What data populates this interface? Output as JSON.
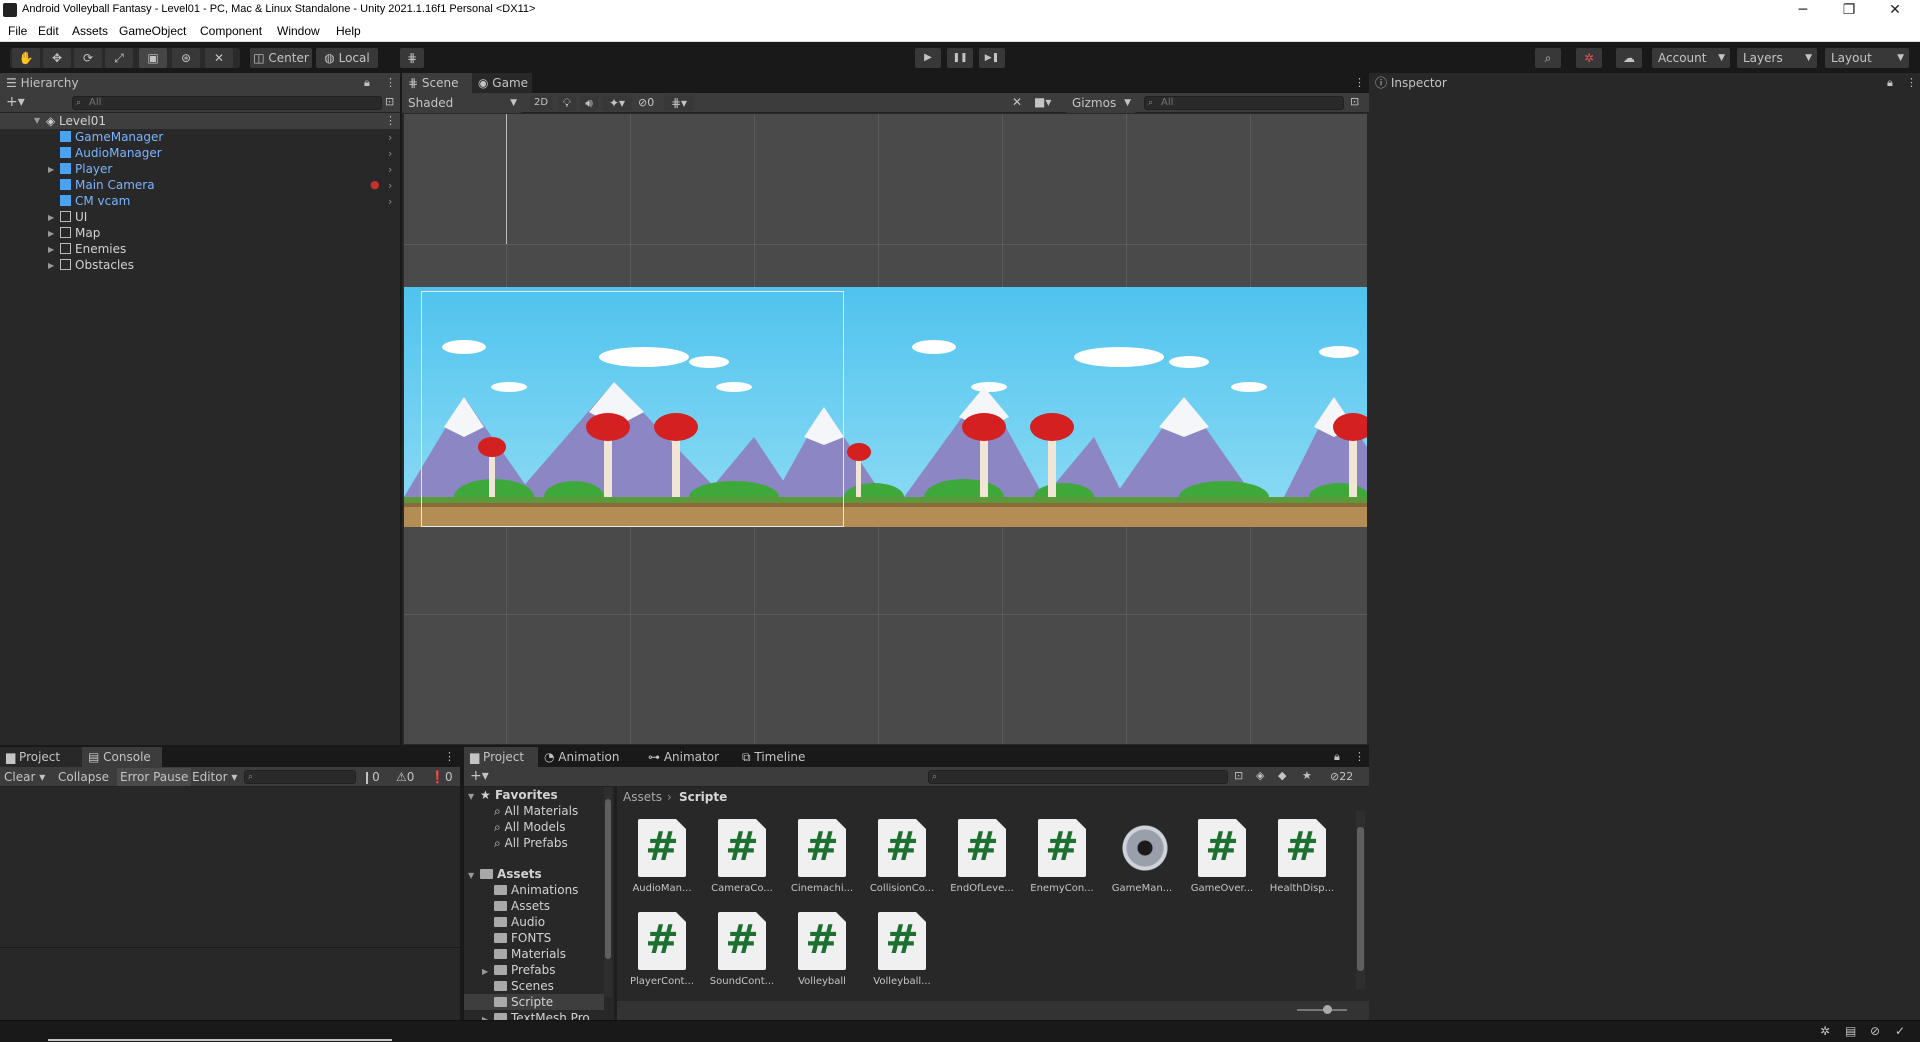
{
  "window": {
    "title": "Android Volleyball Fantasy - Level01 - PC, Mac & Linux Standalone - Unity 2021.1.16f1 Personal <DX11>",
    "controls": [
      "─",
      "❐",
      "✕"
    ]
  },
  "menu": [
    "File",
    "Edit",
    "Assets",
    "GameObject",
    "Component",
    "Window",
    "Help"
  ],
  "toolbar": {
    "pivot": "Center",
    "space": "Local",
    "account": "Account",
    "layers": "Layers",
    "layout": "Layout",
    "play_icons": [
      "▶",
      "❚❚",
      "▶❚"
    ]
  },
  "hierarchy": {
    "tab": "Hierarchy",
    "search_placeholder": "All",
    "scene": "Level01",
    "items": [
      {
        "label": "GameManager",
        "prefab": true
      },
      {
        "label": "AudioManager",
        "prefab": true
      },
      {
        "label": "Player",
        "prefab": true
      },
      {
        "label": "Main Camera",
        "prefab": true
      },
      {
        "label": "CM vcam",
        "prefab": true
      },
      {
        "label": "UI",
        "prefab": false
      },
      {
        "label": "Map",
        "prefab": false
      },
      {
        "label": "Enemies",
        "prefab": false
      },
      {
        "label": "Obstacles",
        "prefab": false
      }
    ]
  },
  "scene_view": {
    "tabs": [
      "Scene",
      "Game"
    ],
    "shading": "Shaded",
    "mode_2d": "2D",
    "hidden_count": "0",
    "gizmos": "Gizmos",
    "search_placeholder": "All"
  },
  "inspector": {
    "tab": "Inspector"
  },
  "console": {
    "tabs": [
      "Project",
      "Console"
    ],
    "clear": "Clear",
    "collapse": "Collapse",
    "error_pause": "Error Pause",
    "editor": "Editor",
    "log_count": "0",
    "warning_count": "0",
    "error_count": "0"
  },
  "project": {
    "tabs": [
      "Project",
      "Animation",
      "Animator",
      "Timeline"
    ],
    "hidden_count": "22",
    "breadcrumb": [
      "Assets",
      "Scripte"
    ],
    "favorites": {
      "label": "Favorites",
      "items": [
        "All Materials",
        "All Models",
        "All Prefabs"
      ]
    },
    "assets": {
      "label": "Assets",
      "folders": [
        "Animations",
        "Assets",
        "Audio",
        "FONTS",
        "Materials",
        "Prefabs",
        "Scenes",
        "Scripte",
        "TextMesh Pro"
      ]
    },
    "files": [
      {
        "name": "AudioMan...",
        "type": "script"
      },
      {
        "name": "CameraCo...",
        "type": "script"
      },
      {
        "name": "Cinemachi...",
        "type": "script"
      },
      {
        "name": "CollisionCo...",
        "type": "script"
      },
      {
        "name": "EndOfLeve...",
        "type": "script"
      },
      {
        "name": "EnemyCon...",
        "type": "script"
      },
      {
        "name": "GameMan...",
        "type": "gear"
      },
      {
        "name": "GameOver...",
        "type": "script"
      },
      {
        "name": "HealthDisp...",
        "type": "script"
      },
      {
        "name": "PlayerCont...",
        "type": "script"
      },
      {
        "name": "SoundCont...",
        "type": "script"
      },
      {
        "name": "Volleyball",
        "type": "script"
      },
      {
        "name": "Volleyball...",
        "type": "script"
      }
    ]
  }
}
